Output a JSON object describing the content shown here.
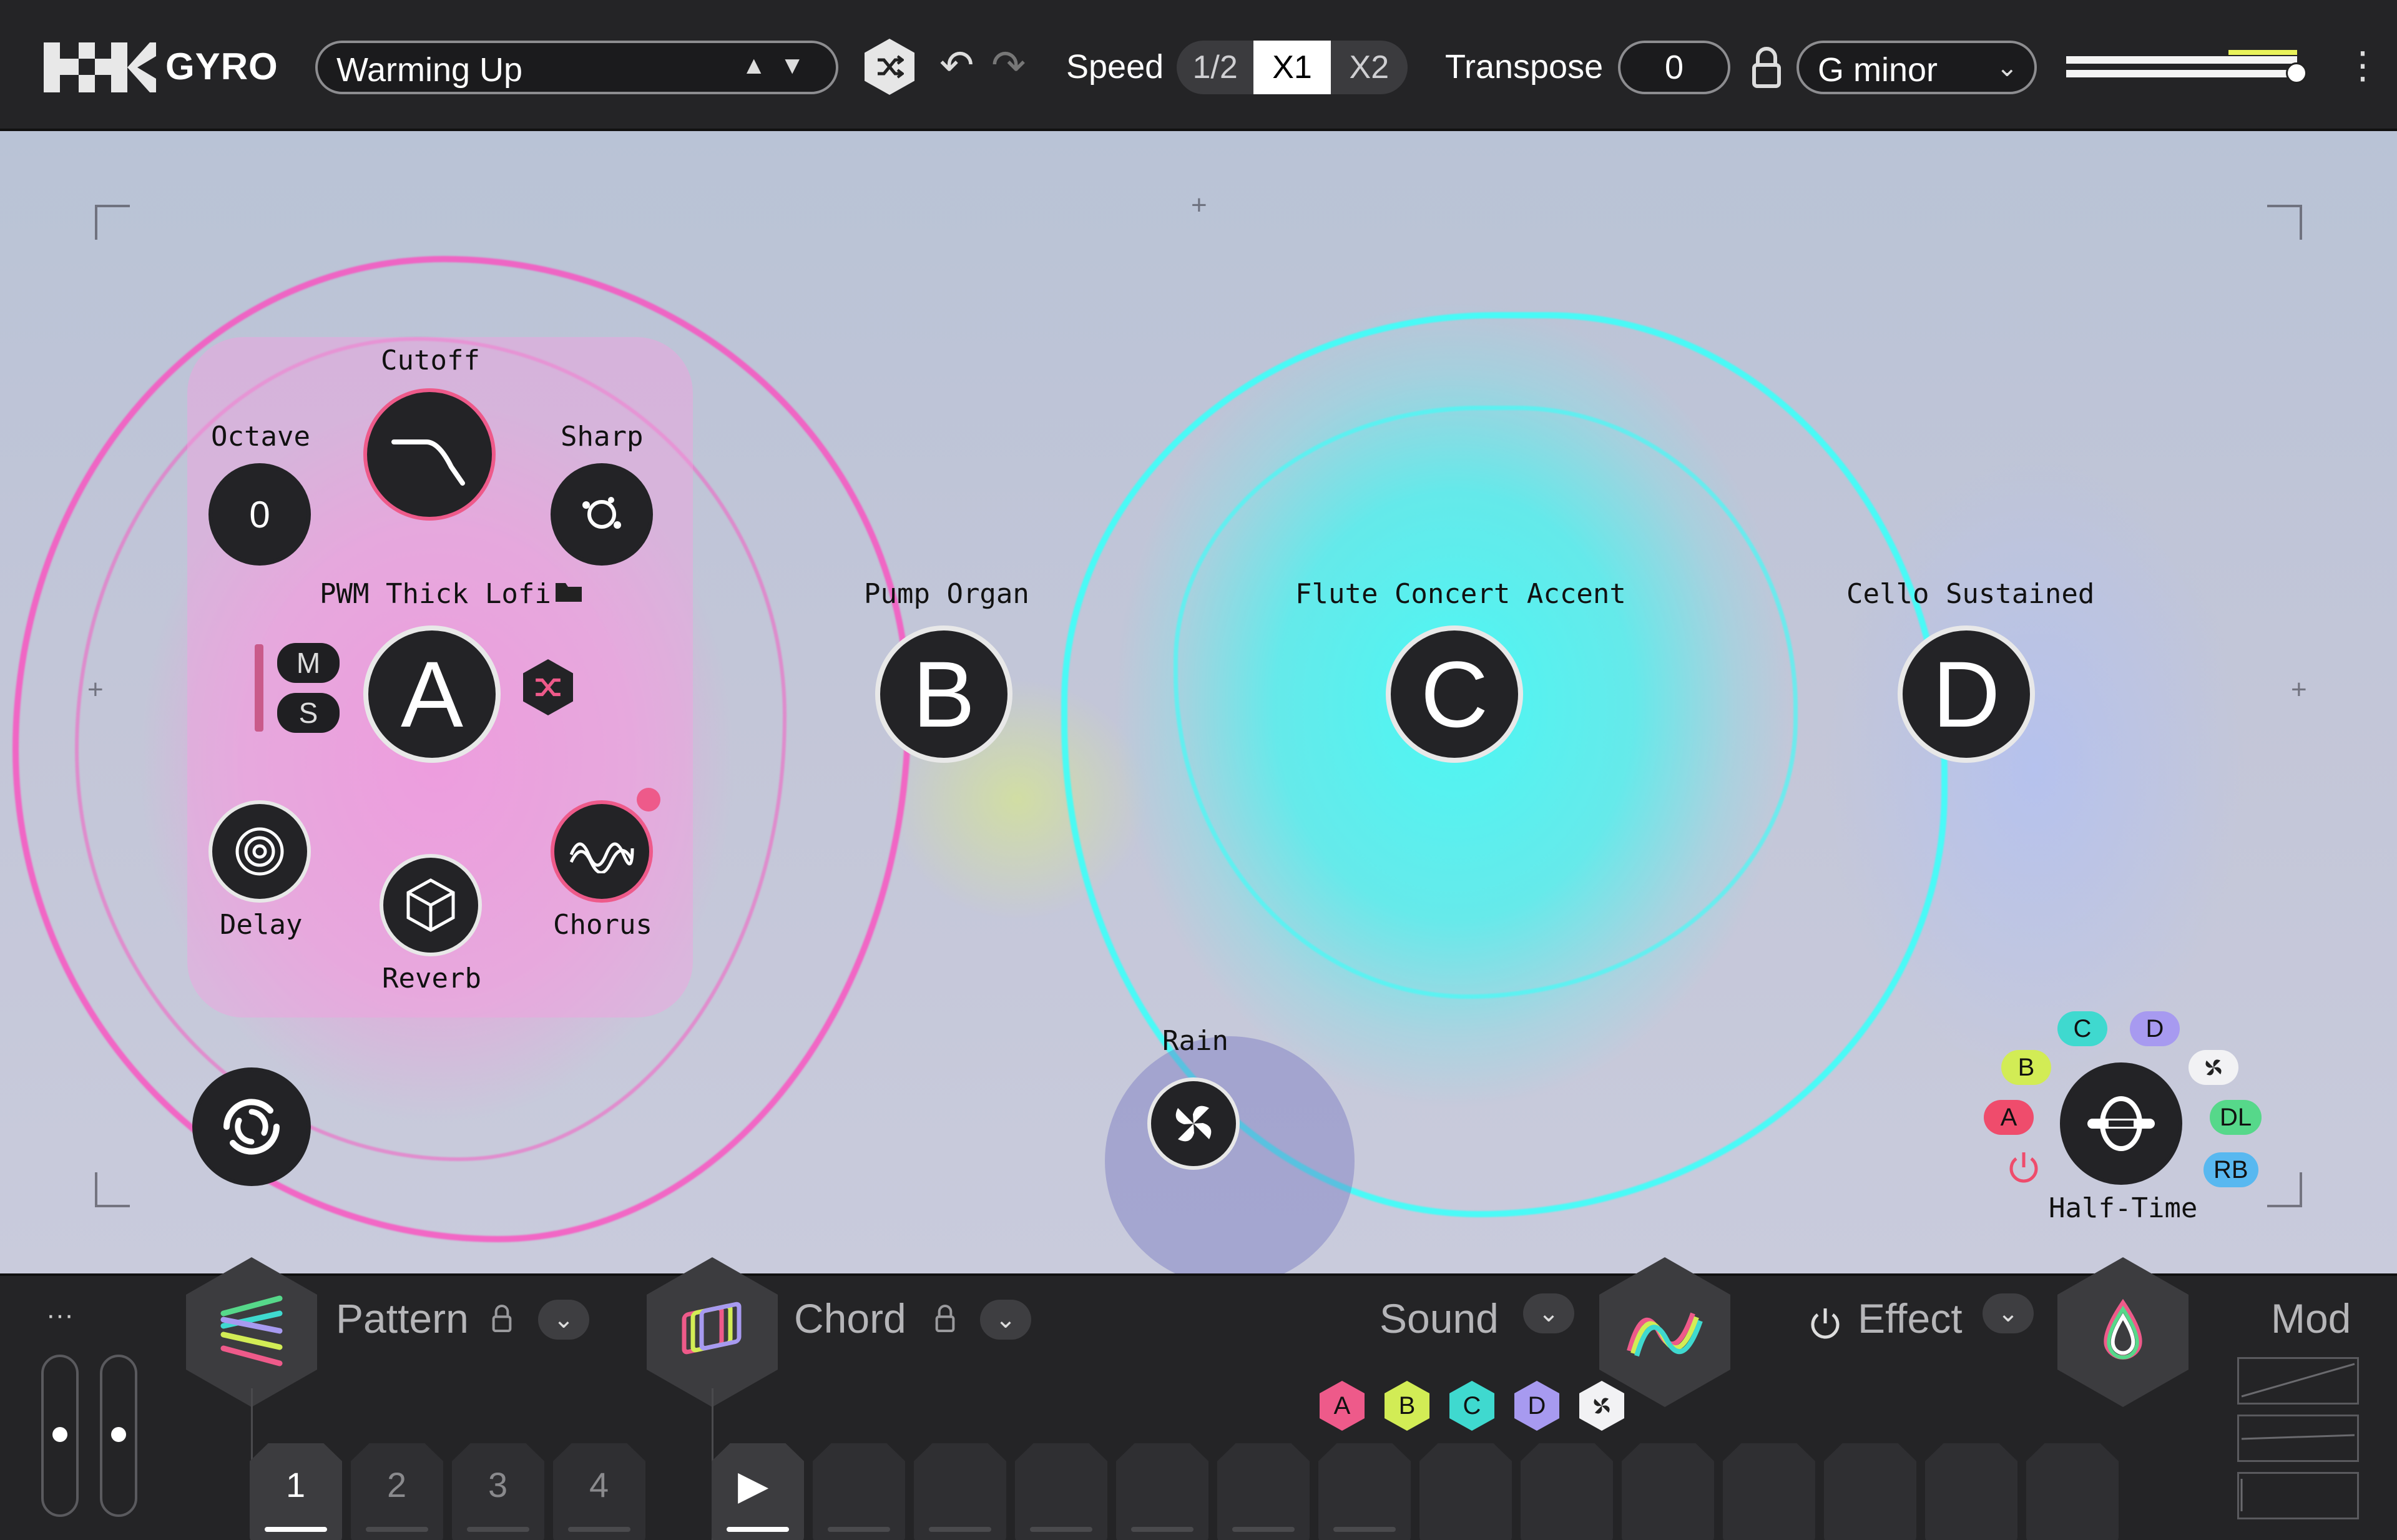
{
  "app": {
    "brand": "GYRO"
  },
  "header": {
    "preset_name": "Warming Up",
    "speed_label": "Speed",
    "speed_options": [
      "1/2",
      "X1",
      "X2"
    ],
    "transpose_label": "Transpose",
    "transpose_value": "0",
    "key": "G minor"
  },
  "layer_a": {
    "name": "PWM Thick Lofi",
    "letter": "A",
    "cutoff_label": "Cutoff",
    "octave_label": "Octave",
    "octave_value": "0",
    "sharp_label": "Sharp",
    "mute": "M",
    "solo": "S",
    "delay_label": "Delay",
    "reverb_label": "Reverb",
    "chorus_label": "Chorus"
  },
  "layers": [
    {
      "name": "Pump Organ",
      "letter": "B"
    },
    {
      "name": "Flute Concert Accent",
      "letter": "C"
    },
    {
      "name": "Cello Sustained",
      "letter": "D"
    }
  ],
  "rain": {
    "label": "Rain"
  },
  "half_time": {
    "label": "Half-Time",
    "badges": {
      "a": "A",
      "b": "B",
      "c": "C",
      "d": "D",
      "dl": "DL",
      "rb": "RB"
    }
  },
  "bottom": {
    "more": "···",
    "pattern_label": "Pattern",
    "chord_label": "Chord",
    "sound_label": "Sound",
    "effect_label": "Effect",
    "mod_label": "Mod",
    "pattern_slots": [
      "1",
      "2",
      "3",
      "4"
    ],
    "sound_targets": [
      "A",
      "B",
      "C",
      "D"
    ]
  },
  "colors": {
    "pink": "#ee5a8a",
    "cyan": "#3fd9cf",
    "lime": "#d2ec55",
    "violet": "#a79af0",
    "green": "#56d88a",
    "blue": "#58b8f0",
    "red": "#ef4c6c"
  }
}
